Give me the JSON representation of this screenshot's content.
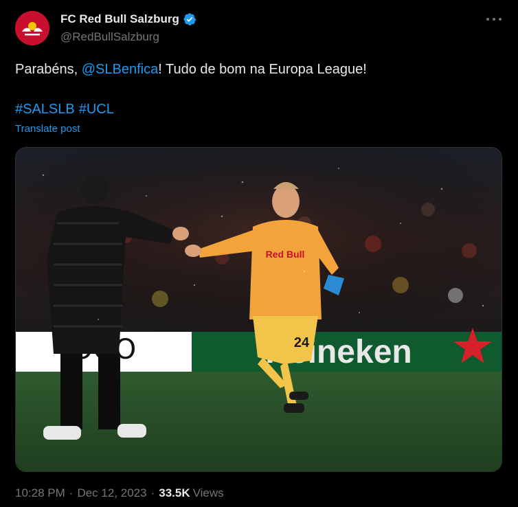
{
  "tweet": {
    "author_name": "FC Red Bull Salzburg",
    "author_handle": "@RedBullSalzburg",
    "text_before": "Parabéns, ",
    "mention": "@SLBenfica",
    "text_after": "! Tudo de bom na Europa League!",
    "hashtags": [
      "#SALSLB",
      "#UCL"
    ],
    "translate_label": "Translate post",
    "time": "10:28 PM",
    "date": "Dec 12, 2023",
    "views_count": "33.5K",
    "views_label": "Views",
    "separator": "·"
  },
  "media": {
    "board_left_text": "OOO",
    "board_right_text": "Heineken",
    "jersey_brand": "Red Bull",
    "jersey_number": "24"
  },
  "colors": {
    "accent": "#1d9bf0",
    "brand": "#c8102e",
    "muted": "#71767b"
  },
  "icons": {
    "verified": "verified-badge-icon",
    "more": "more-dots-icon",
    "avatar": "red-bull-logo"
  }
}
